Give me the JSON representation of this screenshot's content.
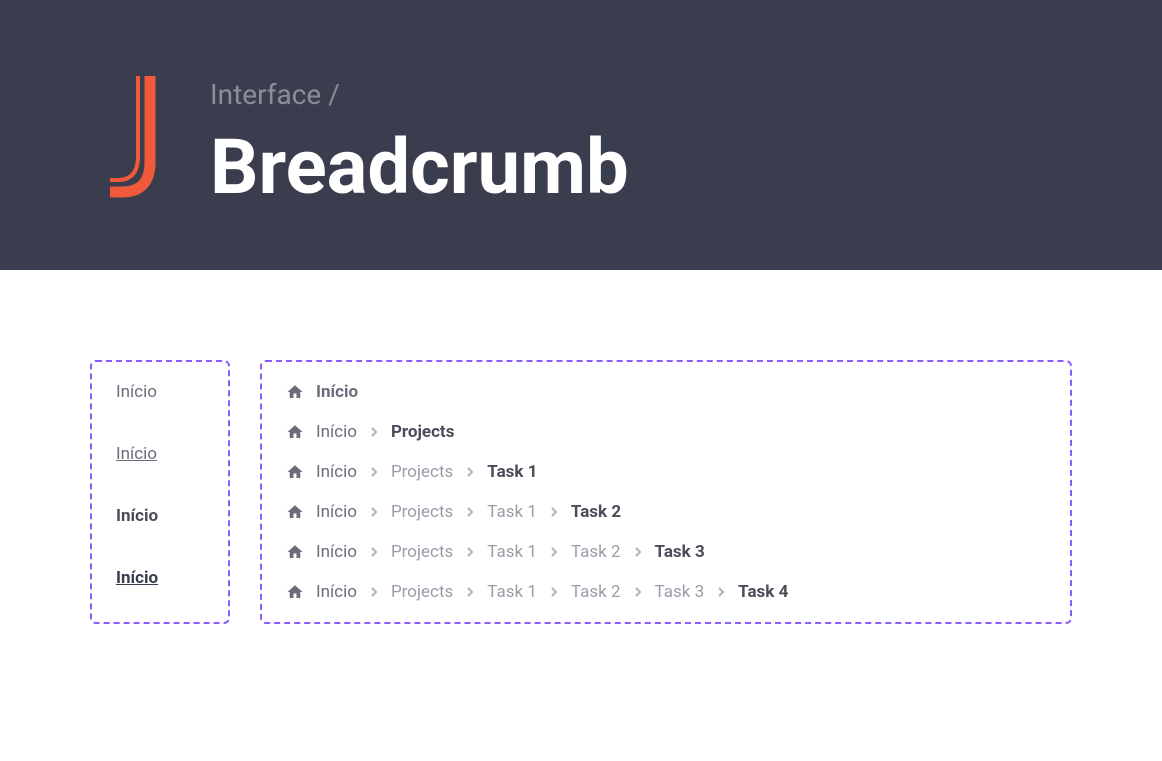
{
  "header": {
    "category": "Interface /",
    "title": "Breadcrumb"
  },
  "variants": {
    "items": [
      {
        "label": "Início",
        "style": "plain"
      },
      {
        "label": "Início",
        "style": "underline"
      },
      {
        "label": "Início",
        "style": "bold"
      },
      {
        "label": "Início",
        "style": "bold-underline"
      }
    ]
  },
  "examples": {
    "rows": [
      {
        "crumbs": [
          "Início"
        ]
      },
      {
        "crumbs": [
          "Início",
          "Projects"
        ]
      },
      {
        "crumbs": [
          "Início",
          "Projects",
          "Task 1"
        ]
      },
      {
        "crumbs": [
          "Início",
          "Projects",
          "Task 1",
          "Task 2"
        ]
      },
      {
        "crumbs": [
          "Início",
          "Projects",
          "Task 1",
          "Task 2",
          "Task 3"
        ]
      },
      {
        "crumbs": [
          "Início",
          "Projects",
          "Task 1",
          "Task 2",
          "Task 3",
          "Task 4"
        ]
      }
    ]
  }
}
